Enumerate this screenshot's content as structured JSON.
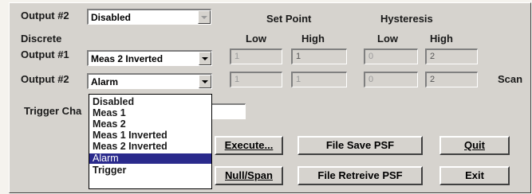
{
  "labels": {
    "output2_top": "Output #2",
    "set_point": "Set Point",
    "hysteresis": "Hysteresis",
    "discrete": "Discrete",
    "low1": "Low",
    "high1": "High",
    "low2": "Low",
    "high2": "High",
    "output1": "Output #1",
    "output2": "Output #2",
    "scan": "Scan",
    "trigger": "Trigger Cha"
  },
  "combos": {
    "top_disabled": "Disabled",
    "output1": "Meas 2 Inverted",
    "output2": "Alarm"
  },
  "fields": {
    "out1_sp_low": "1",
    "out1_sp_high": "1",
    "out1_hy_low": "0",
    "out1_hy_high": "2",
    "out2_sp_low": "1",
    "out2_sp_high": "1",
    "out2_hy_low": "0",
    "out2_hy_high": "2",
    "trigger": ""
  },
  "dropdown": {
    "options": [
      "Disabled",
      "Meas 1",
      "Meas 2",
      "Meas 1 Inverted",
      "Meas 2 Inverted",
      "Alarm",
      "Trigger"
    ],
    "selected": "Alarm"
  },
  "buttons": {
    "execute": "Execute...",
    "file_save_psf": "File Save PSF",
    "quit": "Quit",
    "null_span": "Null/Span",
    "file_retreive_psf": "File Retreive PSF",
    "exit": "Exit"
  }
}
